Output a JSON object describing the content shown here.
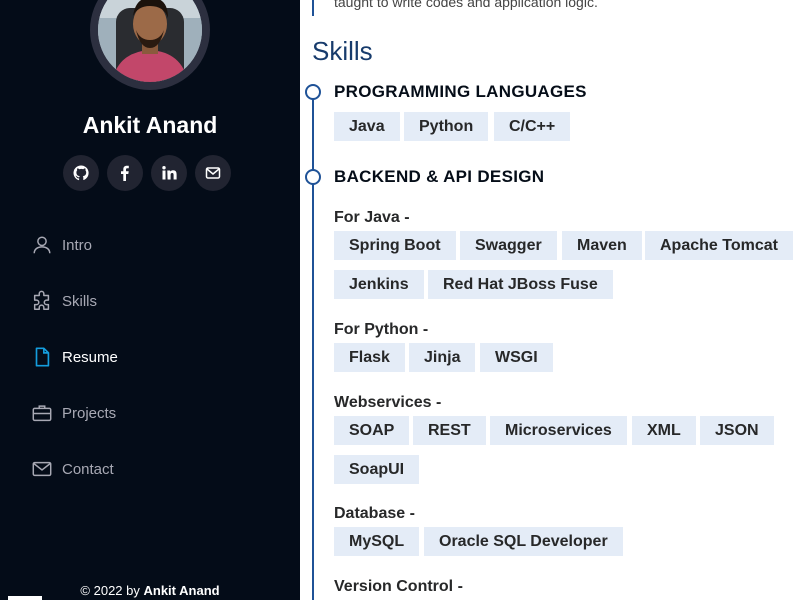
{
  "sidebar": {
    "name": "Ankit Anand",
    "socials": [
      {
        "icon": "github-icon"
      },
      {
        "icon": "facebook-icon"
      },
      {
        "icon": "linkedin-icon"
      },
      {
        "icon": "mail-icon"
      }
    ],
    "nav": [
      {
        "label": "Intro",
        "icon": "person-icon"
      },
      {
        "label": "Skills",
        "icon": "puzzle-icon"
      },
      {
        "label": "Resume",
        "icon": "document-icon"
      },
      {
        "label": "Projects",
        "icon": "briefcase-icon"
      },
      {
        "label": "Contact",
        "icon": "envelope-icon"
      }
    ],
    "active_nav": "Resume",
    "footer_prefix": "© 2022 by",
    "footer_name": "Ankit Anand"
  },
  "main": {
    "intro_tail": "taught to write codes and application logic.",
    "skills_title": "Skills",
    "categories": [
      {
        "title": "PROGRAMMING LANGUAGES"
      },
      {
        "title": "BACKEND & API DESIGN"
      }
    ],
    "programming_tags": [
      "Java",
      "Python",
      "C/C++"
    ],
    "groups": {
      "java": {
        "label": "For Java -",
        "tags": [
          "Spring Boot",
          "Swagger",
          "Maven",
          "Apache Tomcat",
          "Jenkins",
          "Red Hat JBoss Fuse"
        ]
      },
      "python": {
        "label": "For Python -",
        "tags": [
          "Flask",
          "Jinja",
          "WSGI"
        ]
      },
      "web": {
        "label": "Webservices -",
        "tags": [
          "SOAP",
          "REST",
          "Microservices",
          "XML",
          "JSON",
          "SoapUI"
        ]
      },
      "db": {
        "label": "Database -",
        "tags": [
          "MySQL",
          "Oracle SQL Developer"
        ]
      },
      "vc": {
        "label": "Version Control -"
      }
    }
  },
  "colors": {
    "sidebar_bg": "#040c18",
    "accent": "#1f5297",
    "tag_bg": "#e4ecf7",
    "active_icon": "#149ddd"
  }
}
